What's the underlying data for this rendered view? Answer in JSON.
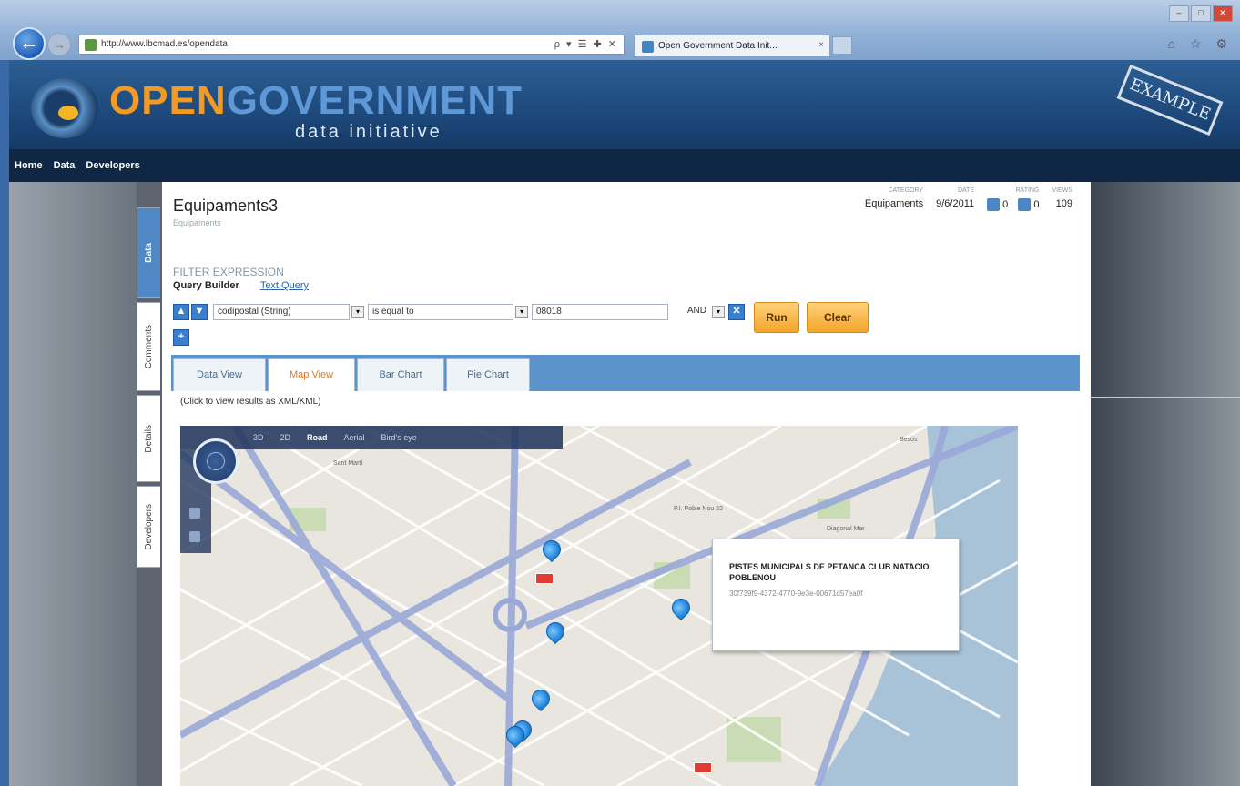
{
  "browser": {
    "url": "http://www.lbcmad.es/opendata",
    "tab_title": "Open Government Data Init...",
    "tab_close": "×",
    "back_glyph": "←",
    "forward_glyph": "→",
    "addr_tools": "ρ ▾ ☰ ✚ ✕",
    "win_min": "–",
    "win_max": "□",
    "win_close": "✕",
    "toolbar_icons": "⌂ ☆ ⚙"
  },
  "banner": {
    "logo_open": "OPEN",
    "logo_government": "GOVERNMENT",
    "logo_sub": "data initiative",
    "stamp": "EXAMPLE"
  },
  "nav": {
    "items": [
      "Home",
      "Data",
      "Developers"
    ]
  },
  "side_tabs": [
    "Data",
    "Comments",
    "Details",
    "Developers"
  ],
  "dataset": {
    "title": "Equipaments3",
    "category_line": "Equipaments",
    "meta_labels": {
      "category": "CATEGORY",
      "date": "DATE",
      "rating": "RATING",
      "views": "VIEWS"
    },
    "category": "Equipaments",
    "date": "9/6/2011",
    "rating_up": "0",
    "rating_down": "0",
    "views": "109"
  },
  "filter": {
    "label": "FILTER EXPRESSION",
    "query_builder": "Query Builder",
    "text_query": "Text Query",
    "up_glyph": "▲",
    "down_glyph": "▼",
    "add_glyph": "+",
    "remove_glyph": "✕",
    "dropdown_glyph": "▾",
    "field": "codipostal (String)",
    "operator": "is equal to",
    "value": "08018",
    "logic": "AND",
    "run": "Run",
    "clear": "Clear"
  },
  "views": {
    "tabs": [
      "Data View",
      "Map View",
      "Bar Chart",
      "Pie Chart"
    ],
    "active": "Map View",
    "results_link": "(Click to view results as XML/KML)"
  },
  "map": {
    "controls": [
      "3D",
      "2D",
      "Road",
      "Aerial",
      "Bird's eye"
    ],
    "active_control": "Road",
    "labels": [
      "Sant Martí",
      "P.I. Poble Nou 22",
      "Diagonal Mar",
      "Besòs"
    ],
    "popup": {
      "title": "PISTES MUNICIPALS DE PETANCA CLUB NATACIO POBLENOU",
      "id": "30f739f9-4372-4770-9e3e-00671d57ea0f"
    },
    "colors": {
      "water": "#a8c3d8",
      "road_major": "#9aa8d8",
      "land": "#e9e6df",
      "park": "#c9dcb4",
      "pin": "#1b7fd6"
    }
  }
}
